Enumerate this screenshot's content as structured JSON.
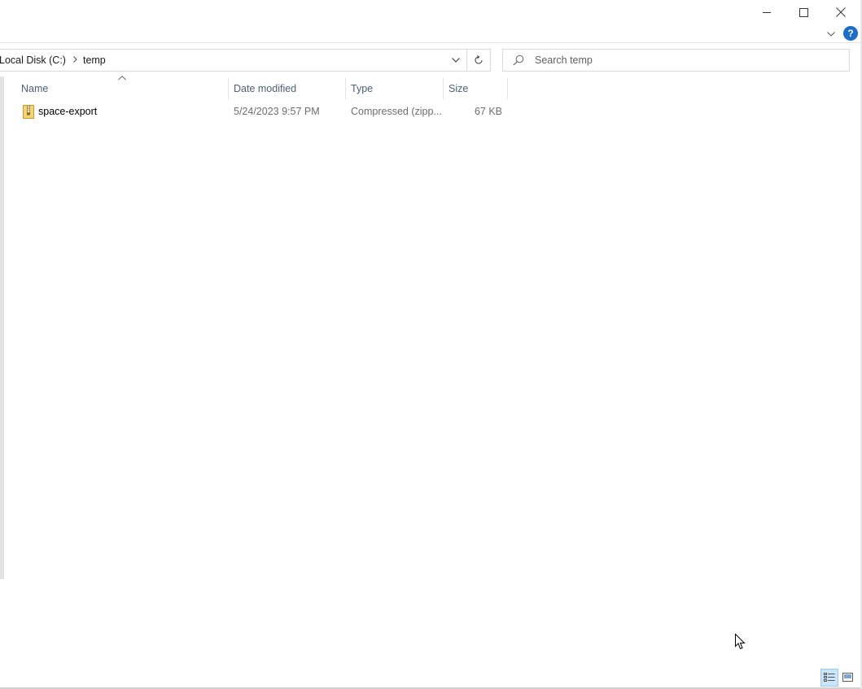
{
  "titlebar": {
    "minimize_icon": "minimize-icon",
    "maximize_icon": "maximize-icon",
    "close_icon": "close-icon"
  },
  "ribbon": {
    "help_label": "?"
  },
  "address_bar": {
    "breadcrumbs": [
      "Local Disk (C:)",
      "temp"
    ]
  },
  "search": {
    "placeholder": "Search temp"
  },
  "columns": {
    "name": "Name",
    "date": "Date modified",
    "type": "Type",
    "size": "Size"
  },
  "files": [
    {
      "name": "space-export",
      "date": "5/24/2023 9:57 PM",
      "type": "Compressed (zipp...",
      "size": "67 KB"
    }
  ],
  "colors": {
    "accent": "#1c6ec9",
    "header_text": "#4c607a",
    "selected_view": "#cce4f7"
  }
}
